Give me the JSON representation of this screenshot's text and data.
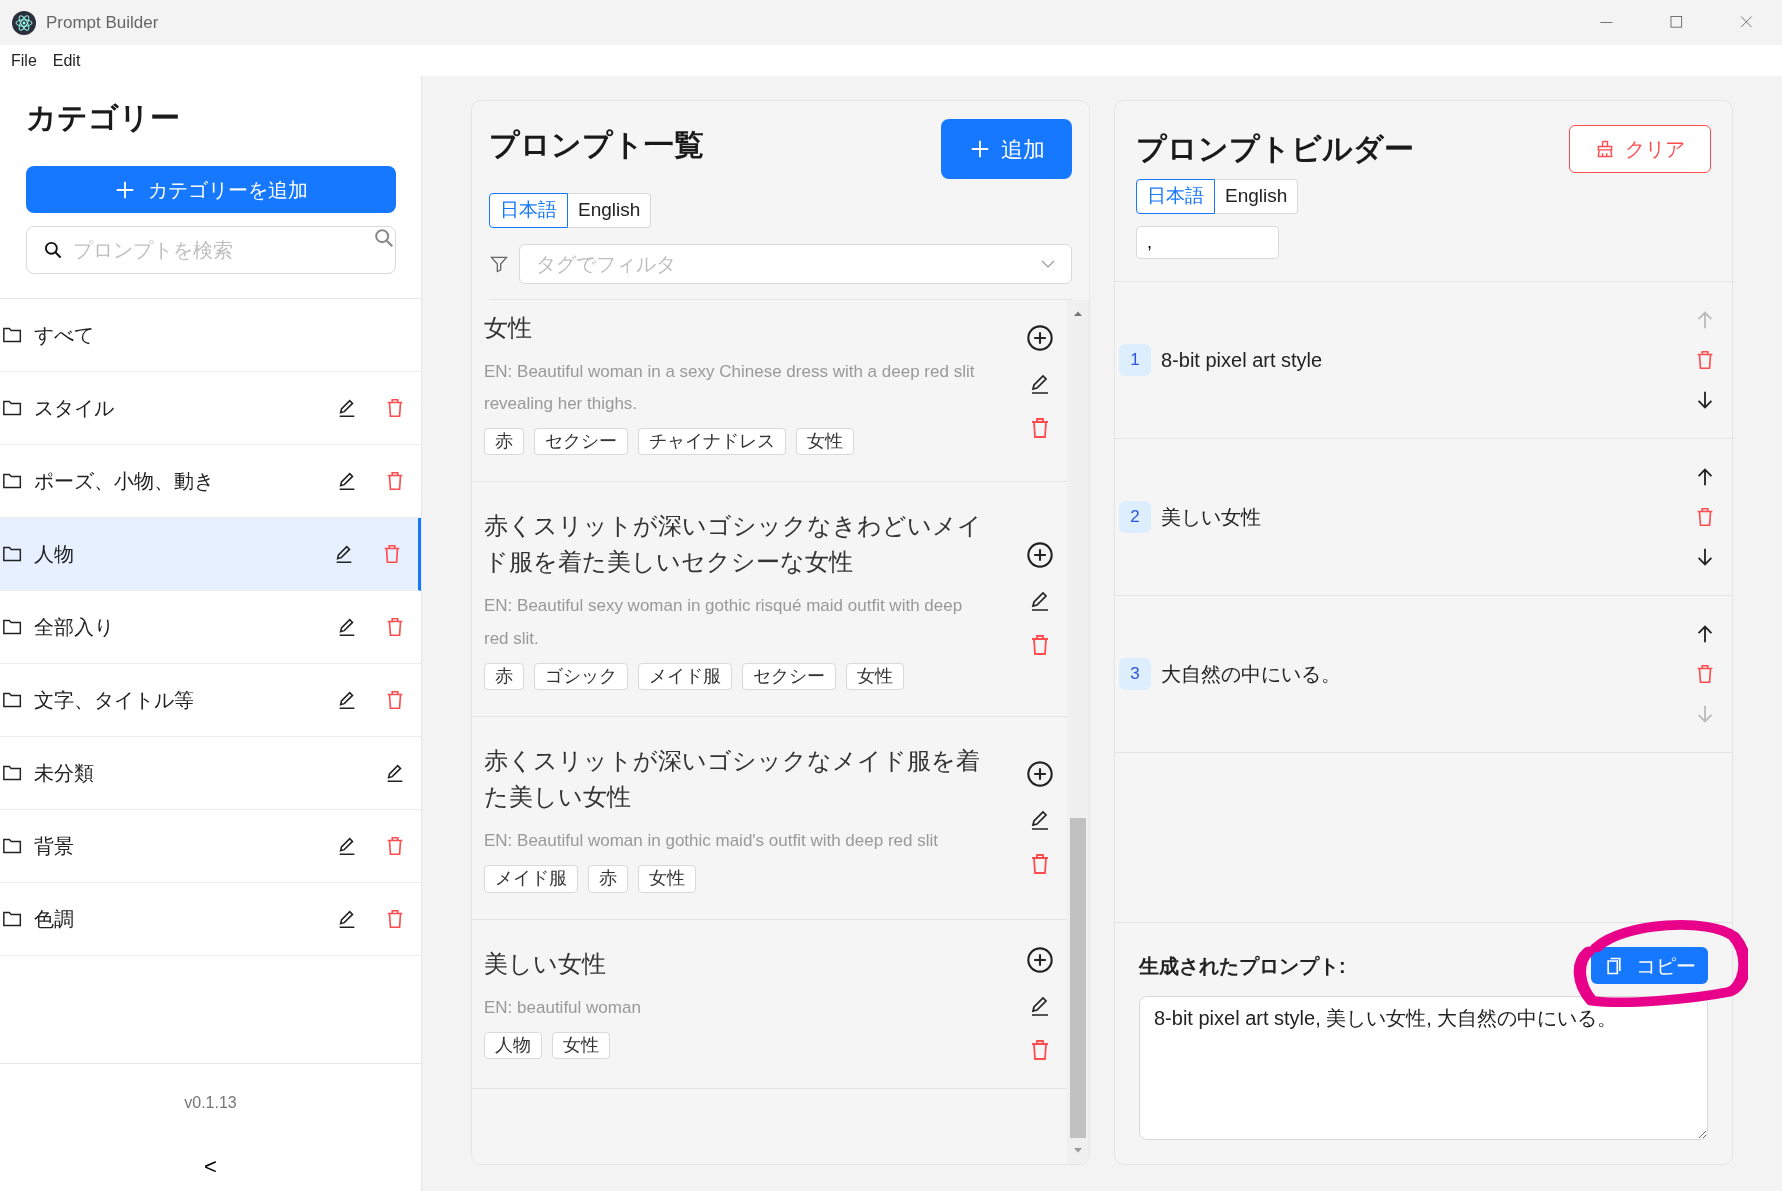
{
  "window": {
    "title": "Prompt Builder"
  },
  "menu": [
    "File",
    "Edit"
  ],
  "sidebar": {
    "title": "カテゴリー",
    "add_button": "カテゴリーを追加",
    "search": {
      "placeholder": "プロンプトを検索"
    },
    "categories": [
      {
        "name": "すべて",
        "selected": false,
        "editable": false,
        "deletable": false
      },
      {
        "name": "スタイル",
        "selected": false,
        "editable": true,
        "deletable": true
      },
      {
        "name": "ポーズ、小物、動き",
        "selected": false,
        "editable": true,
        "deletable": true
      },
      {
        "name": "人物",
        "selected": true,
        "editable": true,
        "deletable": true
      },
      {
        "name": "全部入り",
        "selected": false,
        "editable": true,
        "deletable": true
      },
      {
        "name": "文字、タイトル等",
        "selected": false,
        "editable": true,
        "deletable": true
      },
      {
        "name": "未分類",
        "selected": false,
        "editable": true,
        "deletable": false
      },
      {
        "name": "背景",
        "selected": false,
        "editable": true,
        "deletable": true
      },
      {
        "name": "色調",
        "selected": false,
        "editable": true,
        "deletable": true
      }
    ],
    "version": "v0.1.13",
    "collapse": "<"
  },
  "prompt_list": {
    "title": "プロンプト一覧",
    "add_button": "追加",
    "languages": [
      {
        "label": "日本語",
        "selected": true
      },
      {
        "label": "English",
        "selected": false
      }
    ],
    "filter": {
      "placeholder": "タグでフィルタ"
    },
    "items": [
      {
        "title": "女性",
        "en": "EN: Beautiful woman in a sexy Chinese dress with a deep red slit revealing her thighs.",
        "tags": [
          "赤",
          "セクシー",
          "チャイナドレス",
          "女性"
        ]
      },
      {
        "title": "赤くスリットが深いゴシックなきわどいメイド服を着た美しいセクシーな女性",
        "en": "EN: Beautiful sexy woman in gothic risqué maid outfit with deep red slit.",
        "tags": [
          "赤",
          "ゴシック",
          "メイド服",
          "セクシー",
          "女性"
        ]
      },
      {
        "title": "赤くスリットが深いゴシックなメイド服を着た美しい女性",
        "en": "EN: Beautiful woman in gothic maid's outfit with deep red slit",
        "tags": [
          "メイド服",
          "赤",
          "女性"
        ]
      },
      {
        "title": "美しい女性",
        "en": "EN: beautiful woman",
        "tags": [
          "人物",
          "女性"
        ]
      }
    ]
  },
  "builder": {
    "title": "プロンプトビルダー",
    "clear_button": "クリア",
    "languages": [
      {
        "label": "日本語",
        "selected": true
      },
      {
        "label": "English",
        "selected": false
      }
    ],
    "separator": ",",
    "items": [
      {
        "number": "1",
        "text": "8-bit pixel art style",
        "up_disabled": true,
        "down_disabled": false
      },
      {
        "number": "2",
        "text": "美しい女性",
        "up_disabled": false,
        "down_disabled": false
      },
      {
        "number": "3",
        "text": "大自然の中にいる。",
        "up_disabled": false,
        "down_disabled": true
      }
    ],
    "output_label": "生成されたプロンプト:",
    "copy_button": "コピー",
    "output": "8-bit pixel art style, 美しい女性, 大自然の中にいる。"
  },
  "annotations": [
    {
      "kind": "circle",
      "color": "#e8008a"
    }
  ]
}
